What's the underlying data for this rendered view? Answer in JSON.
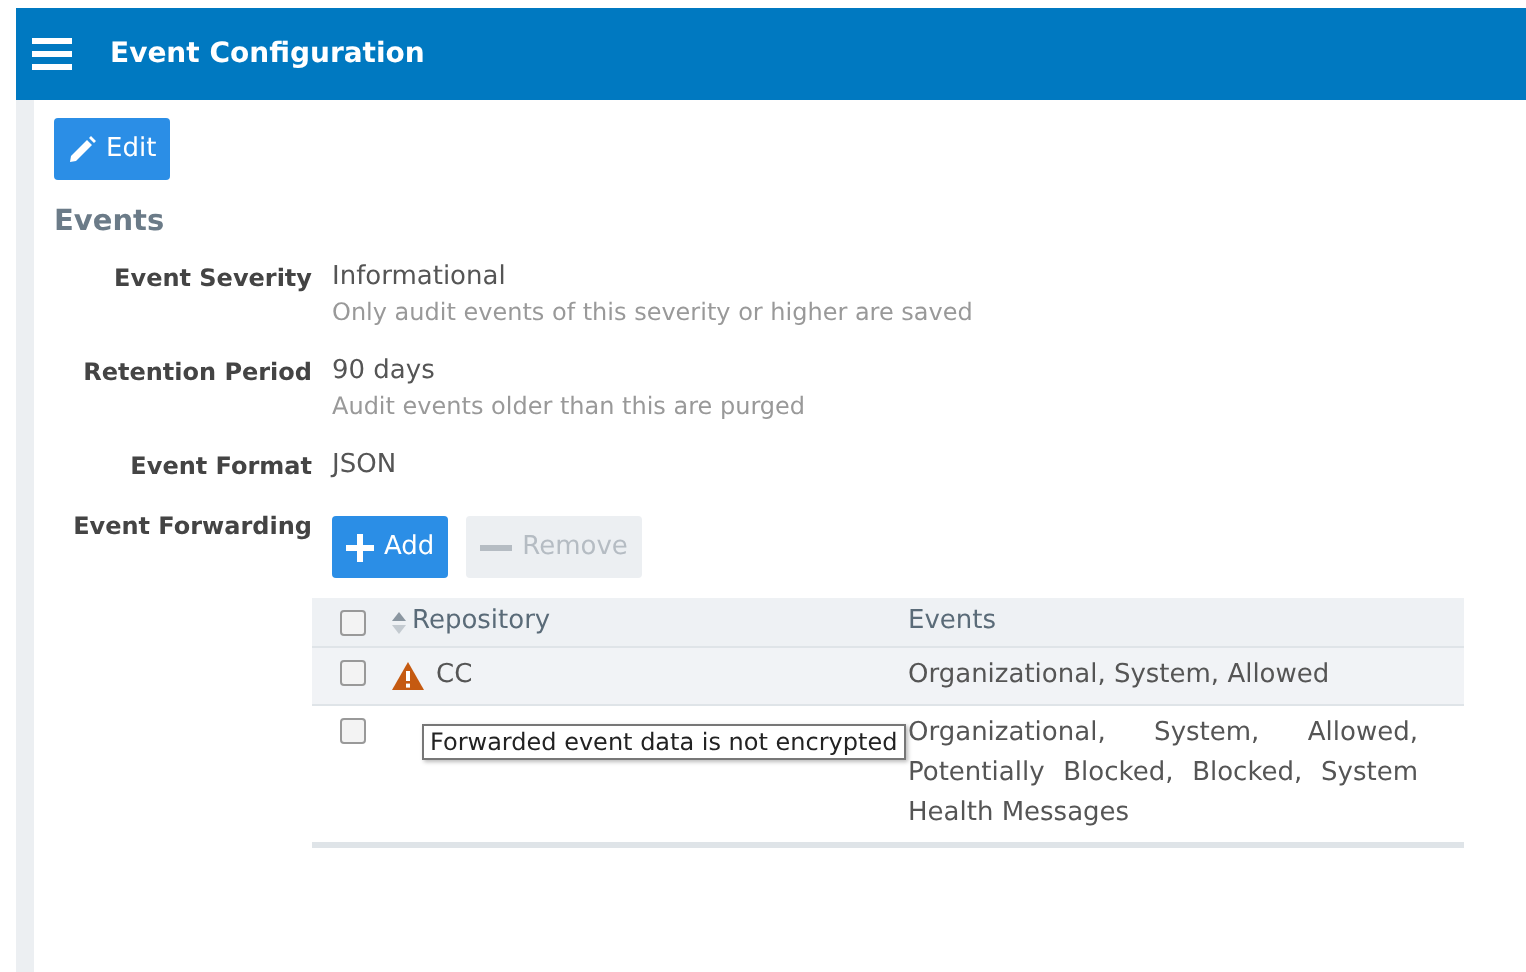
{
  "header": {
    "title": "Event Configuration"
  },
  "edit_button": {
    "label": "Edit"
  },
  "section": {
    "title": "Events"
  },
  "fields": [
    {
      "label": "Event Severity",
      "value": "Informational",
      "hint": "Only audit events of this severity or higher are saved"
    },
    {
      "label": "Retention Period",
      "value": "90 days",
      "hint": "Audit events older than this are purged"
    },
    {
      "label": "Event Format",
      "value": "JSON"
    }
  ],
  "forwarding": {
    "label": "Event Forwarding",
    "buttons": [
      {
        "kind": "add",
        "label": "Add",
        "disabled": false
      },
      {
        "kind": "remove",
        "label": "Remove",
        "disabled": true
      }
    ],
    "table": {
      "header_checked": false,
      "columns": [
        "Repository",
        "Events"
      ],
      "rows": [
        {
          "checked": false,
          "hovered": true,
          "warning": true,
          "repository": "CC",
          "events": "Organizational, System, Allowed"
        },
        {
          "checked": false,
          "hovered": false,
          "events": "Organizational, System, Allowed, Potentially Blocked, Blocked, System Health Messages",
          "tooltip": "Forwarded event data is not encrypted"
        }
      ]
    }
  }
}
